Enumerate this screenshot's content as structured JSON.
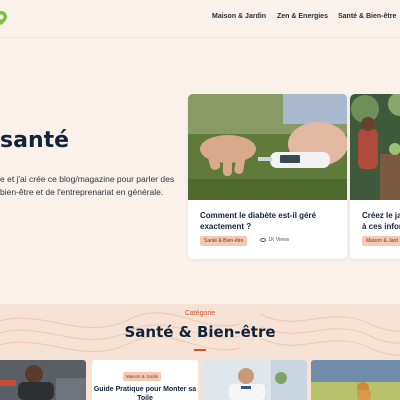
{
  "nav": {
    "items": [
      "Maison & Jardin",
      "Zen & Energies",
      "Santé & Bien-être"
    ]
  },
  "hero": {
    "title": "santé",
    "line1": "e et j'ai crée ce blog/magazine pour parler des",
    "line2": "bien-être et de l'entreprenariat en générale."
  },
  "cards": [
    {
      "title": "Comment le diabète est-il géré exactement ?",
      "badge": "Santé & Bien-être",
      "views": "1K Views"
    },
    {
      "title": "Créez le ja",
      "title2": "à ces infor",
      "badge": "Maison & Jard"
    }
  ],
  "category": {
    "kicker": "Catégorie",
    "title": "Santé & Bien-être"
  },
  "tiles": [
    {
      "badge": "Maison & Jardin",
      "title": "Guide Pratique pour Monter sa Toile"
    }
  ],
  "colors": {
    "background": "#faf1ea",
    "accent": "#d0532b",
    "badge_bg": "#f6c9b3",
    "band": "#f6e3d6"
  }
}
